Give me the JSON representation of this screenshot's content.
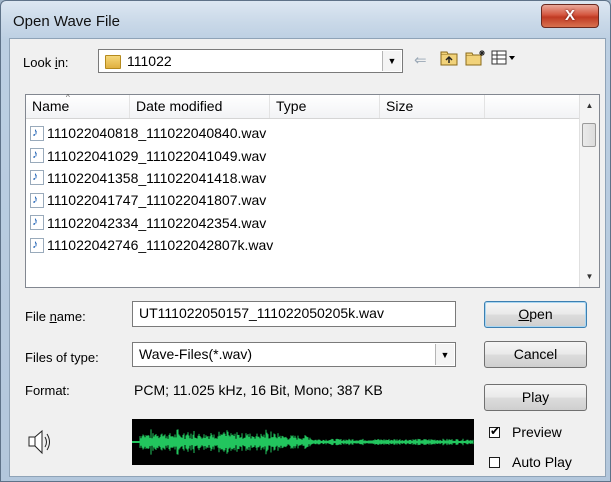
{
  "window": {
    "title": "Open Wave File",
    "close_label": "X"
  },
  "lookin": {
    "label_before": "Look ",
    "label_accel": "i",
    "label_after": "n:",
    "value": "111022"
  },
  "toolbar": {
    "back_icon": "back-arrow-icon",
    "up_icon": "up-folder-icon",
    "new_folder_icon": "new-folder-icon",
    "views_icon": "views-menu-icon"
  },
  "columns": [
    "Name",
    "Date modified",
    "Type",
    "Size"
  ],
  "files": [
    "111022040818_111022040840.wav",
    "111022041029_111022041049.wav",
    "111022041358_111022041418.wav",
    "111022041747_111022041807.wav",
    "111022042334_111022042354.wav",
    "111022042746_111022042807k.wav"
  ],
  "filename": {
    "label_before": "File ",
    "label_accel": "n",
    "label_after": "ame:",
    "value": "UT111022050157_111022050205k.wav"
  },
  "filetype": {
    "label": "Files of type:",
    "value": "Wave-Files(*.wav)"
  },
  "format": {
    "label": "Format:",
    "value": "PCM; 11.025 kHz, 16 Bit, Mono; 387 KB"
  },
  "buttons": {
    "open_accel": "O",
    "open_rest": "pen",
    "cancel": "Cancel",
    "play": "Play"
  },
  "preview": {
    "label": "Preview",
    "checked": true
  },
  "autoplay": {
    "label": "Auto Play",
    "checked": false
  },
  "colors": {
    "waveform": "#22c55e",
    "waveform_bg": "#000000"
  }
}
